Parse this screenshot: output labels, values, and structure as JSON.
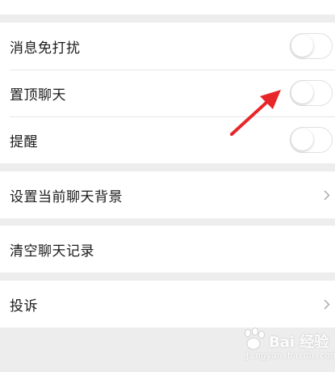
{
  "settings": {
    "group1": [
      {
        "label": "消息免打扰",
        "toggle": false
      },
      {
        "label": "置顶聊天",
        "toggle": false
      },
      {
        "label": "提醒",
        "toggle": false
      }
    ],
    "set_background": "设置当前聊天背景",
    "clear_history": "清空聊天记录",
    "complaint": "投诉"
  },
  "watermark": {
    "brand": "Bai 经验",
    "url": "jingyan.baidu.com"
  },
  "colors": {
    "background": "#ededed",
    "card": "#ffffff",
    "arrow": "#e8262a"
  }
}
